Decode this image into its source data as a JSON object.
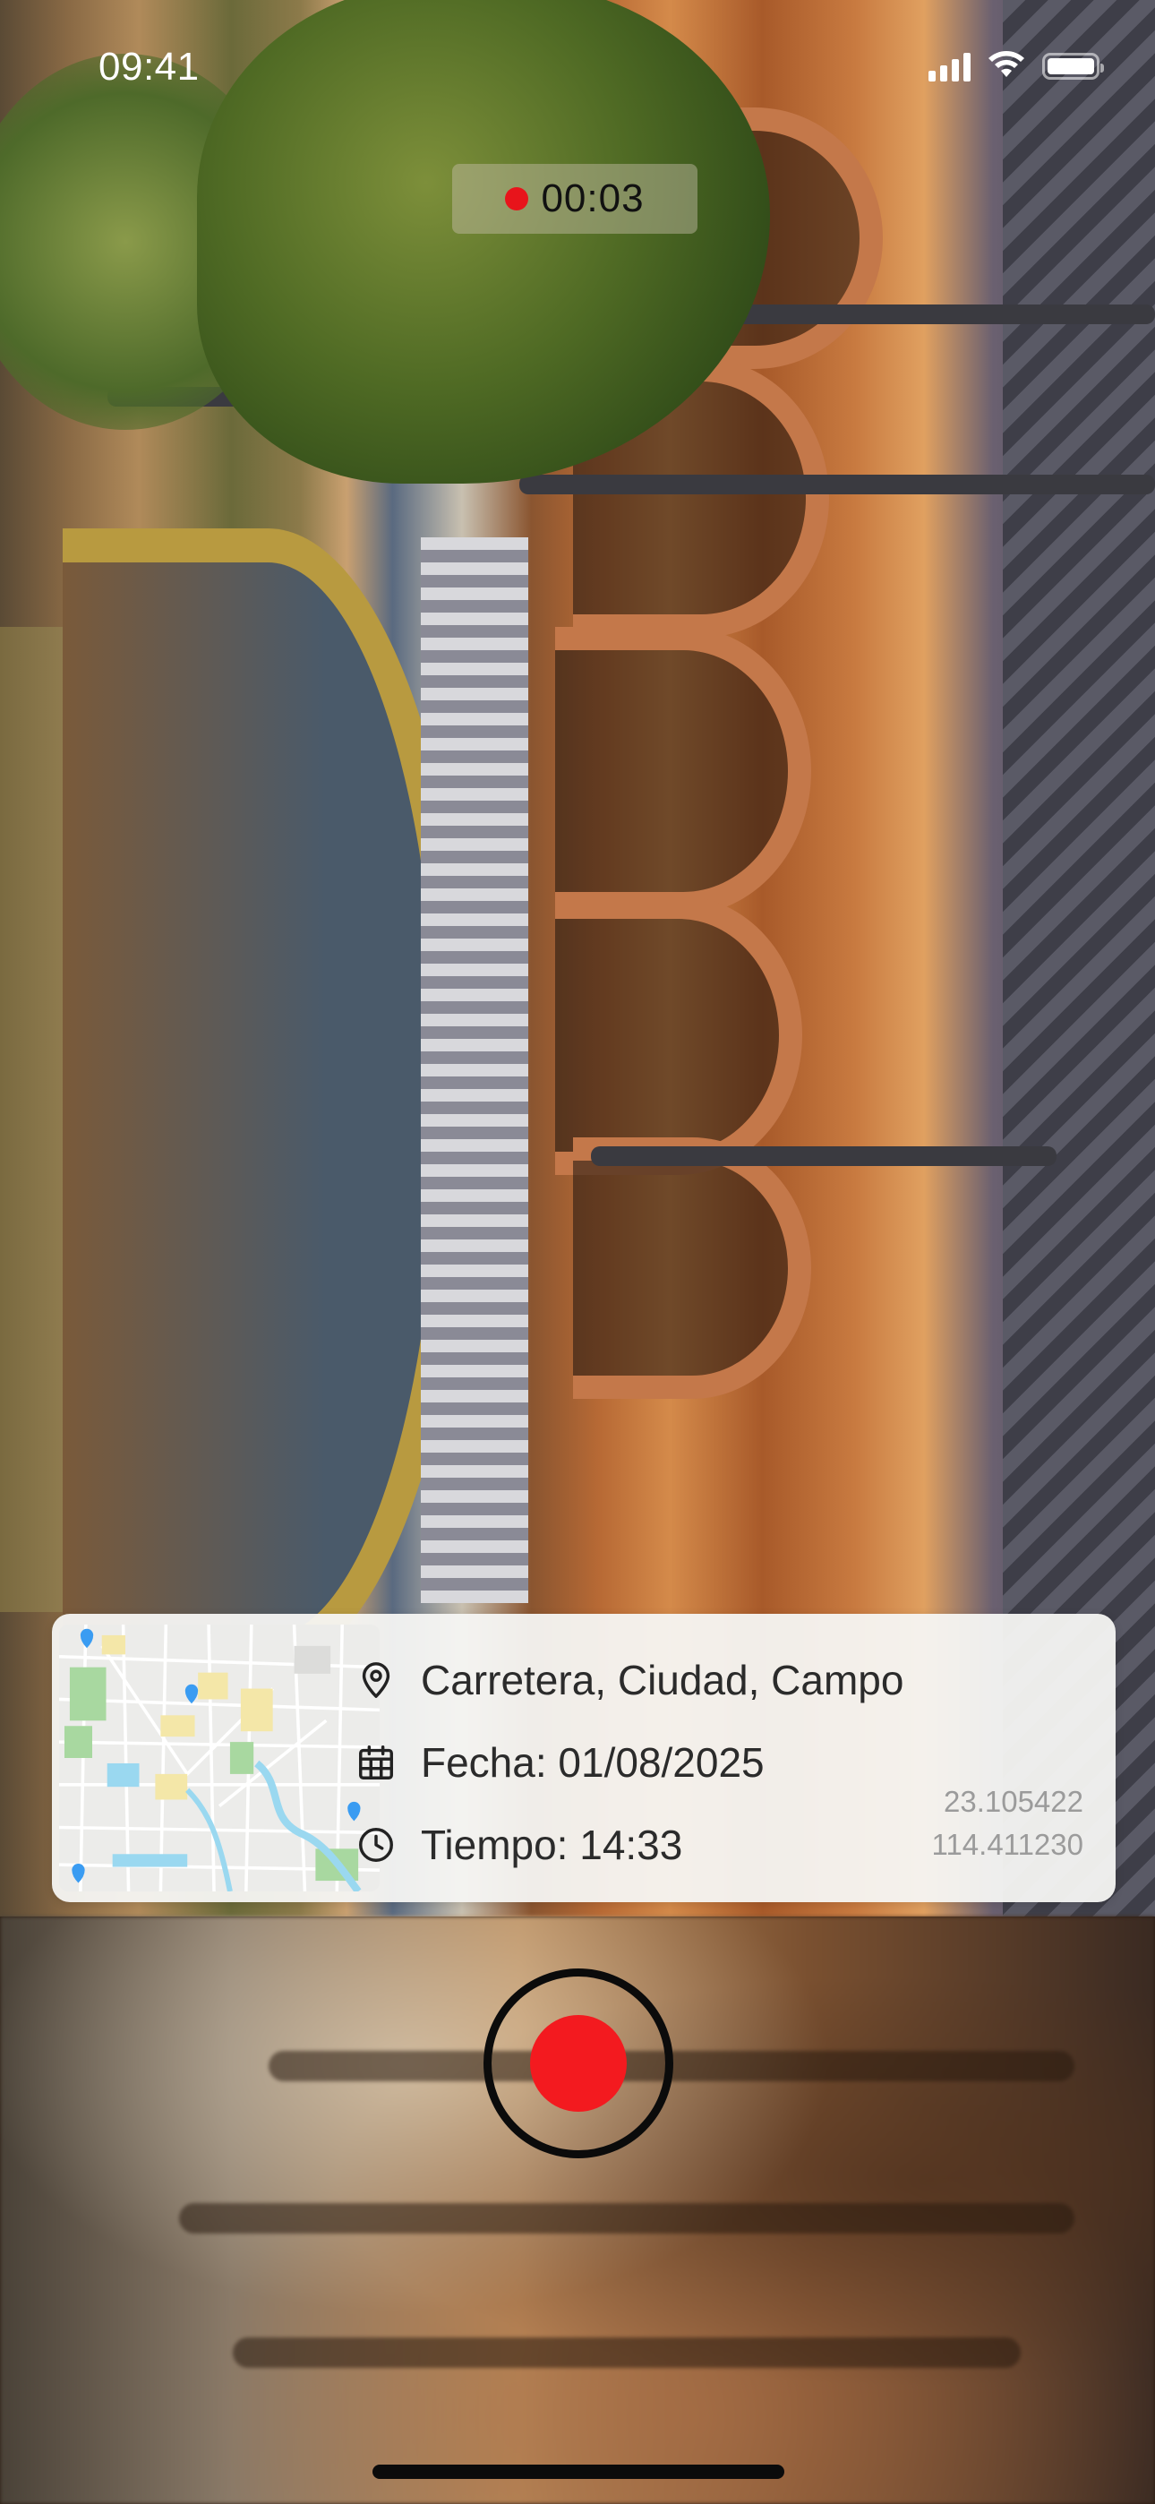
{
  "status_bar": {
    "time": "09:41",
    "icons": [
      "cellular-signal-icon",
      "wifi-icon",
      "battery-icon"
    ]
  },
  "recording": {
    "timer": "00:03",
    "indicator_color": "#e8141b"
  },
  "location_card": {
    "map_thumbnail": "map-icon",
    "address": "Carretera, Ciudad, Campo",
    "date": "Fecha: 01/08/2025",
    "time": "Tiempo: 14:33",
    "latitude": "23.105422",
    "longitude": "114.411230",
    "icons": {
      "address": "location-pin-icon",
      "date": "calendar-icon",
      "time": "clock-icon"
    }
  },
  "controls": {
    "record_button": "record-button",
    "record_color": "#f31a1f"
  }
}
